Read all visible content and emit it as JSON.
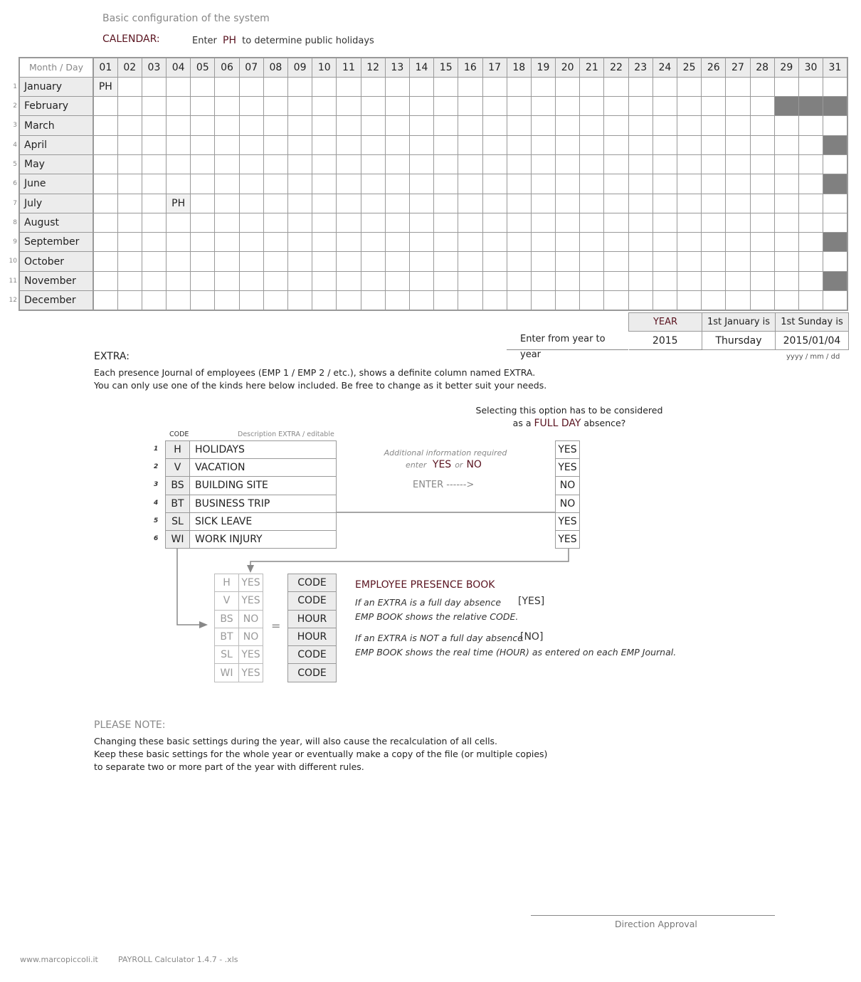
{
  "title": "Basic configuration of the system",
  "calendar": {
    "label": "CALENDAR:",
    "hint_pre": "Enter",
    "hint_code": "PH",
    "hint_post": "to determine public holidays",
    "header_label": "Month / Day",
    "days": [
      "01",
      "02",
      "03",
      "04",
      "05",
      "06",
      "07",
      "08",
      "09",
      "10",
      "11",
      "12",
      "13",
      "14",
      "15",
      "16",
      "17",
      "18",
      "19",
      "20",
      "21",
      "22",
      "23",
      "24",
      "25",
      "26",
      "27",
      "28",
      "29",
      "30",
      "31"
    ],
    "months": [
      {
        "num": "1",
        "name": "January",
        "days_in_month": 31,
        "entries": {
          "1": "PH"
        }
      },
      {
        "num": "2",
        "name": "February",
        "days_in_month": 28,
        "entries": {}
      },
      {
        "num": "3",
        "name": "March",
        "days_in_month": 31,
        "entries": {}
      },
      {
        "num": "4",
        "name": "April",
        "days_in_month": 30,
        "entries": {}
      },
      {
        "num": "5",
        "name": "May",
        "days_in_month": 31,
        "entries": {}
      },
      {
        "num": "6",
        "name": "June",
        "days_in_month": 30,
        "entries": {}
      },
      {
        "num": "7",
        "name": "July",
        "days_in_month": 31,
        "entries": {
          "4": "PH"
        }
      },
      {
        "num": "8",
        "name": "August",
        "days_in_month": 31,
        "entries": {}
      },
      {
        "num": "9",
        "name": "September",
        "days_in_month": 30,
        "entries": {}
      },
      {
        "num": "10",
        "name": "October",
        "days_in_month": 31,
        "entries": {}
      },
      {
        "num": "11",
        "name": "November",
        "days_in_month": 30,
        "entries": {}
      },
      {
        "num": "12",
        "name": "December",
        "days_in_month": 31,
        "entries": {}
      }
    ]
  },
  "year_box": {
    "label": "Enter from year to year",
    "year_header": "YEAR",
    "jan_header": "1st January is",
    "sunday_header": "1st Sunday is",
    "year": "2015",
    "jan_day": "Thursday",
    "first_sunday": "2015/01/04",
    "date_format": "yyyy / mm / dd"
  },
  "extra": {
    "heading": "EXTRA:",
    "line1": "Each presence Journal of employees (EMP 1 / EMP 2 / etc.), shows a definite column named EXTRA.",
    "line2": "You can only use one of the kinds here below included. Be free to change as it better suit your needs.",
    "code_header": "CODE",
    "desc_header": "Description EXTRA / editable",
    "full_day_q1": "Selecting this option has to be considered",
    "full_day_q2_pre": "as a",
    "full_day_q2_em": "FULL DAY",
    "full_day_q2_post": "absence?",
    "add_info": "Additional information required",
    "enter_pre": "enter",
    "yes": "YES",
    "or": "or",
    "no": "NO",
    "enter_arrow": "ENTER  ------>",
    "rows": [
      {
        "num": "1",
        "code": "H",
        "desc": "HOLIDAYS",
        "full_day": "YES",
        "result": "CODE"
      },
      {
        "num": "2",
        "code": "V",
        "desc": "VACATION",
        "full_day": "YES",
        "result": "CODE"
      },
      {
        "num": "3",
        "code": "BS",
        "desc": "BUILDING SITE",
        "full_day": "NO",
        "result": "HOUR"
      },
      {
        "num": "4",
        "code": "BT",
        "desc": "BUSINESS TRIP",
        "full_day": "NO",
        "result": "HOUR"
      },
      {
        "num": "5",
        "code": "SL",
        "desc": "SICK LEAVE",
        "full_day": "YES",
        "result": "CODE"
      },
      {
        "num": "6",
        "code": "WI",
        "desc": "WORK INJURY",
        "full_day": "YES",
        "result": "CODE"
      }
    ],
    "equals": "="
  },
  "presence_book": {
    "heading": "EMPLOYEE PRESENCE BOOK",
    "yes_line1": "If an EXTRA is a full day absence",
    "yes_tag": "[YES]",
    "yes_line2": "EMP BOOK shows the relative CODE.",
    "no_line1": "If an EXTRA is NOT a full day absence",
    "no_tag": "[NO]",
    "no_line2": "EMP BOOK shows the real time (HOUR) as entered on each EMP Journal."
  },
  "note": {
    "heading": "PLEASE NOTE:",
    "line1": "Changing these basic settings during the year, will also cause the recalculation of all cells.",
    "line2": "Keep these basic settings for the whole year or eventually make a copy of the file (or multiple copies)",
    "line3": "to separate two or more part of the year with different rules."
  },
  "signature": "Direction Approval",
  "footer": {
    "site": "www.marcopiccoli.it",
    "product": "PAYROLL Calculator 1.4.7  -  .xls"
  }
}
